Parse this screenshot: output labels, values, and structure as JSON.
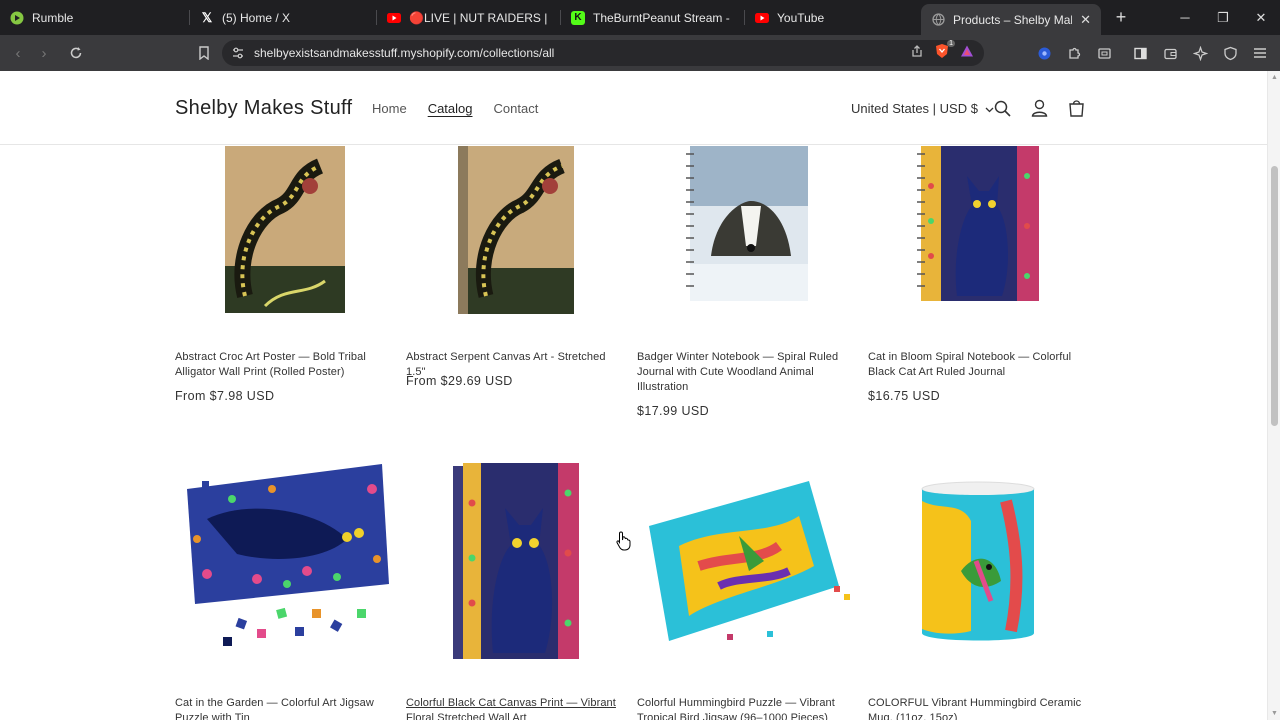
{
  "tabs": [
    {
      "title": "Rumble",
      "icon": "rumble-icon",
      "color": "#85c742"
    },
    {
      "title": "(5) Home / X",
      "icon": "x-icon",
      "color": "#ffffff"
    },
    {
      "title": "🔴LIVE | NUT RAIDERS | NEW YE",
      "icon": "youtube-icon",
      "color": "#ff0000"
    },
    {
      "title": "TheBurntPeanut Stream - Watch",
      "icon": "kick-icon",
      "color": "#53fc18"
    },
    {
      "title": "YouTube",
      "icon": "youtube-icon",
      "color": "#ff0000"
    },
    {
      "title": "Products – Shelby Makes Stuff",
      "icon": "globe-icon",
      "color": "#9a9a9a"
    }
  ],
  "browser": {
    "url": "shelbyexistsandmakesstuff.myshopify.com/collections/all",
    "new_tab": "+",
    "ext_badge": "1"
  },
  "site": {
    "brand": "Shelby Makes Stuff",
    "nav": [
      "Home",
      "Catalog",
      "Contact"
    ],
    "currency": "United States | USD $"
  },
  "products": [
    {
      "title": "Abstract Croc Art Poster — Bold Tribal Alligator Wall Print (Rolled Poster)",
      "price": "From $7.98 USD"
    },
    {
      "title": "Abstract Serpent Canvas Art - Stretched 1.5\"",
      "price": "From $29.69 USD"
    },
    {
      "title": "Badger Winter Notebook — Spiral Ruled Journal with Cute Woodland Animal Illustration",
      "price": "$17.99 USD"
    },
    {
      "title": "Cat in Bloom Spiral Notebook — Colorful Black Cat Art Ruled Journal",
      "price": "$16.75 USD"
    },
    {
      "title": "Cat in the Garden — Colorful Art Jigsaw Puzzle with Tin",
      "price": ""
    },
    {
      "title": "Colorful Black Cat Canvas Print — Vibrant Floral Stretched Wall Art",
      "price": ""
    },
    {
      "title": "Colorful Hummingbird Puzzle — Vibrant Tropical Bird Jigsaw (96–1000 Pieces)",
      "price": ""
    },
    {
      "title": "COLORFUL Vibrant Hummingbird Ceramic Mug, (11oz, 15oz)",
      "price": ""
    }
  ]
}
